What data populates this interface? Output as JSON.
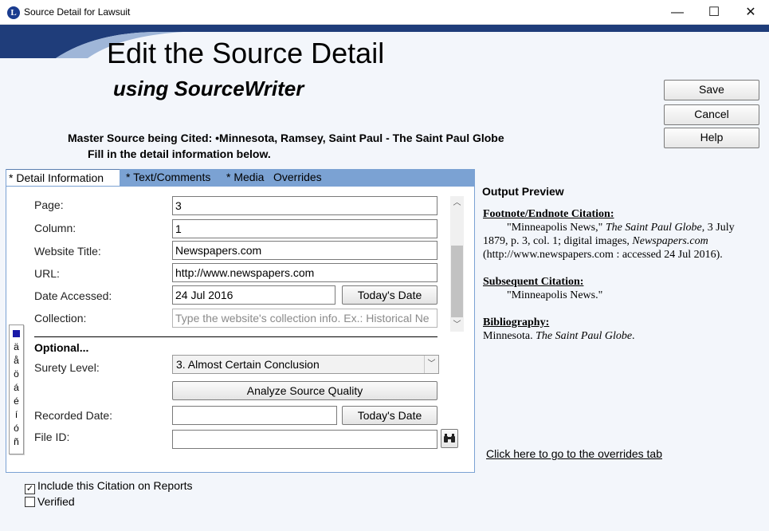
{
  "window": {
    "app_icon": "L",
    "title": "Source Detail for Lawsuit",
    "minimize": "—",
    "maximize": "☐",
    "close": "✕"
  },
  "header": {
    "title": "Edit the Source Detail",
    "subtitle": "using SourceWriter"
  },
  "actions": {
    "save": "Save",
    "cancel": "Cancel",
    "help": "Help"
  },
  "master_source": {
    "label": "Master Source being Cited: •Minnesota, Ramsey, Saint Paul - The Saint Paul Globe",
    "instruction": "Fill in the detail information below."
  },
  "tabs": [
    {
      "label": "* Detail Information",
      "active": true
    },
    {
      "label": "* Text/Comments",
      "active": false
    },
    {
      "label": "* Media",
      "active": false
    },
    {
      "label": "Overrides",
      "active": false
    }
  ],
  "form": {
    "page": {
      "label": "Page:",
      "value": "3"
    },
    "column": {
      "label": "Column:",
      "value": "1"
    },
    "website_title": {
      "label": "Website Title:",
      "value": "Newspapers.com"
    },
    "url": {
      "label": "URL:",
      "value": "http://www.newspapers.com"
    },
    "date_accessed": {
      "label": "Date Accessed:",
      "value": "24 Jul 2016",
      "button": "Today's Date"
    },
    "collection": {
      "label": "Collection:",
      "placeholder": "Type the website's collection info. Ex.: Historical Ne"
    },
    "optional_heading": "Optional...",
    "surety": {
      "label": "Surety Level:",
      "value": "3.  Almost Certain Conclusion"
    },
    "analyze_button": "Analyze Source Quality",
    "recorded_date": {
      "label": "Recorded Date:",
      "value": "",
      "button": "Today's Date"
    },
    "file_id": {
      "label": "File ID:",
      "value": ""
    }
  },
  "accent_chars": [
    "ä",
    "å",
    "ö",
    "á",
    "é",
    "í",
    "ó",
    "ñ"
  ],
  "output_preview": {
    "title": "Output Preview",
    "footnote_heading": "Footnote/Endnote Citation:",
    "footnote_1": "\"Minneapolis News,\" ",
    "footnote_2": "The Saint Paul Globe",
    "footnote_3": ", 3 July 1879, p. 3, col. 1; digital images, ",
    "footnote_4": "Newspapers.com",
    "footnote_5": " (http://www.newspapers.com : accessed 24 Jul 2016).",
    "subsequent_heading": "Subsequent Citation:",
    "subsequent_text": "\"Minneapolis News.\"",
    "bibliography_heading": "Bibliography:",
    "bibliography_1": "Minnesota.  ",
    "bibliography_2": "The Saint Paul Globe",
    "bibliography_3": ".",
    "overrides_link": "Click here to go to the overrides tab"
  },
  "options": {
    "include_on_reports": {
      "label": "Include this Citation on Reports",
      "checked": true
    },
    "verified": {
      "label": "Verified",
      "checked": false
    }
  },
  "colors": {
    "banner": "#1f3d7a",
    "tab_bar": "#7ba2d3"
  }
}
